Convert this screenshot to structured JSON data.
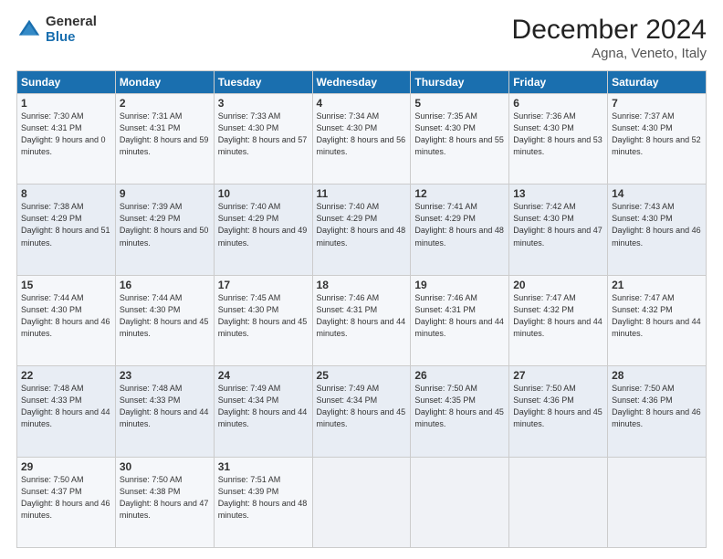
{
  "logo": {
    "general": "General",
    "blue": "Blue"
  },
  "header": {
    "month": "December 2024",
    "location": "Agna, Veneto, Italy"
  },
  "weekdays": [
    "Sunday",
    "Monday",
    "Tuesday",
    "Wednesday",
    "Thursday",
    "Friday",
    "Saturday"
  ],
  "weeks": [
    [
      {
        "day": "1",
        "sunrise": "7:30 AM",
        "sunset": "4:31 PM",
        "daylight": "9 hours and 0 minutes."
      },
      {
        "day": "2",
        "sunrise": "7:31 AM",
        "sunset": "4:31 PM",
        "daylight": "8 hours and 59 minutes."
      },
      {
        "day": "3",
        "sunrise": "7:33 AM",
        "sunset": "4:30 PM",
        "daylight": "8 hours and 57 minutes."
      },
      {
        "day": "4",
        "sunrise": "7:34 AM",
        "sunset": "4:30 PM",
        "daylight": "8 hours and 56 minutes."
      },
      {
        "day": "5",
        "sunrise": "7:35 AM",
        "sunset": "4:30 PM",
        "daylight": "8 hours and 55 minutes."
      },
      {
        "day": "6",
        "sunrise": "7:36 AM",
        "sunset": "4:30 PM",
        "daylight": "8 hours and 53 minutes."
      },
      {
        "day": "7",
        "sunrise": "7:37 AM",
        "sunset": "4:30 PM",
        "daylight": "8 hours and 52 minutes."
      }
    ],
    [
      {
        "day": "8",
        "sunrise": "7:38 AM",
        "sunset": "4:29 PM",
        "daylight": "8 hours and 51 minutes."
      },
      {
        "day": "9",
        "sunrise": "7:39 AM",
        "sunset": "4:29 PM",
        "daylight": "8 hours and 50 minutes."
      },
      {
        "day": "10",
        "sunrise": "7:40 AM",
        "sunset": "4:29 PM",
        "daylight": "8 hours and 49 minutes."
      },
      {
        "day": "11",
        "sunrise": "7:40 AM",
        "sunset": "4:29 PM",
        "daylight": "8 hours and 48 minutes."
      },
      {
        "day": "12",
        "sunrise": "7:41 AM",
        "sunset": "4:29 PM",
        "daylight": "8 hours and 48 minutes."
      },
      {
        "day": "13",
        "sunrise": "7:42 AM",
        "sunset": "4:30 PM",
        "daylight": "8 hours and 47 minutes."
      },
      {
        "day": "14",
        "sunrise": "7:43 AM",
        "sunset": "4:30 PM",
        "daylight": "8 hours and 46 minutes."
      }
    ],
    [
      {
        "day": "15",
        "sunrise": "7:44 AM",
        "sunset": "4:30 PM",
        "daylight": "8 hours and 46 minutes."
      },
      {
        "day": "16",
        "sunrise": "7:44 AM",
        "sunset": "4:30 PM",
        "daylight": "8 hours and 45 minutes."
      },
      {
        "day": "17",
        "sunrise": "7:45 AM",
        "sunset": "4:30 PM",
        "daylight": "8 hours and 45 minutes."
      },
      {
        "day": "18",
        "sunrise": "7:46 AM",
        "sunset": "4:31 PM",
        "daylight": "8 hours and 44 minutes."
      },
      {
        "day": "19",
        "sunrise": "7:46 AM",
        "sunset": "4:31 PM",
        "daylight": "8 hours and 44 minutes."
      },
      {
        "day": "20",
        "sunrise": "7:47 AM",
        "sunset": "4:32 PM",
        "daylight": "8 hours and 44 minutes."
      },
      {
        "day": "21",
        "sunrise": "7:47 AM",
        "sunset": "4:32 PM",
        "daylight": "8 hours and 44 minutes."
      }
    ],
    [
      {
        "day": "22",
        "sunrise": "7:48 AM",
        "sunset": "4:33 PM",
        "daylight": "8 hours and 44 minutes."
      },
      {
        "day": "23",
        "sunrise": "7:48 AM",
        "sunset": "4:33 PM",
        "daylight": "8 hours and 44 minutes."
      },
      {
        "day": "24",
        "sunrise": "7:49 AM",
        "sunset": "4:34 PM",
        "daylight": "8 hours and 44 minutes."
      },
      {
        "day": "25",
        "sunrise": "7:49 AM",
        "sunset": "4:34 PM",
        "daylight": "8 hours and 45 minutes."
      },
      {
        "day": "26",
        "sunrise": "7:50 AM",
        "sunset": "4:35 PM",
        "daylight": "8 hours and 45 minutes."
      },
      {
        "day": "27",
        "sunrise": "7:50 AM",
        "sunset": "4:36 PM",
        "daylight": "8 hours and 45 minutes."
      },
      {
        "day": "28",
        "sunrise": "7:50 AM",
        "sunset": "4:36 PM",
        "daylight": "8 hours and 46 minutes."
      }
    ],
    [
      {
        "day": "29",
        "sunrise": "7:50 AM",
        "sunset": "4:37 PM",
        "daylight": "8 hours and 46 minutes."
      },
      {
        "day": "30",
        "sunrise": "7:50 AM",
        "sunset": "4:38 PM",
        "daylight": "8 hours and 47 minutes."
      },
      {
        "day": "31",
        "sunrise": "7:51 AM",
        "sunset": "4:39 PM",
        "daylight": "8 hours and 48 minutes."
      },
      null,
      null,
      null,
      null
    ]
  ],
  "labels": {
    "sunrise": "Sunrise:",
    "sunset": "Sunset:",
    "daylight": "Daylight:"
  }
}
